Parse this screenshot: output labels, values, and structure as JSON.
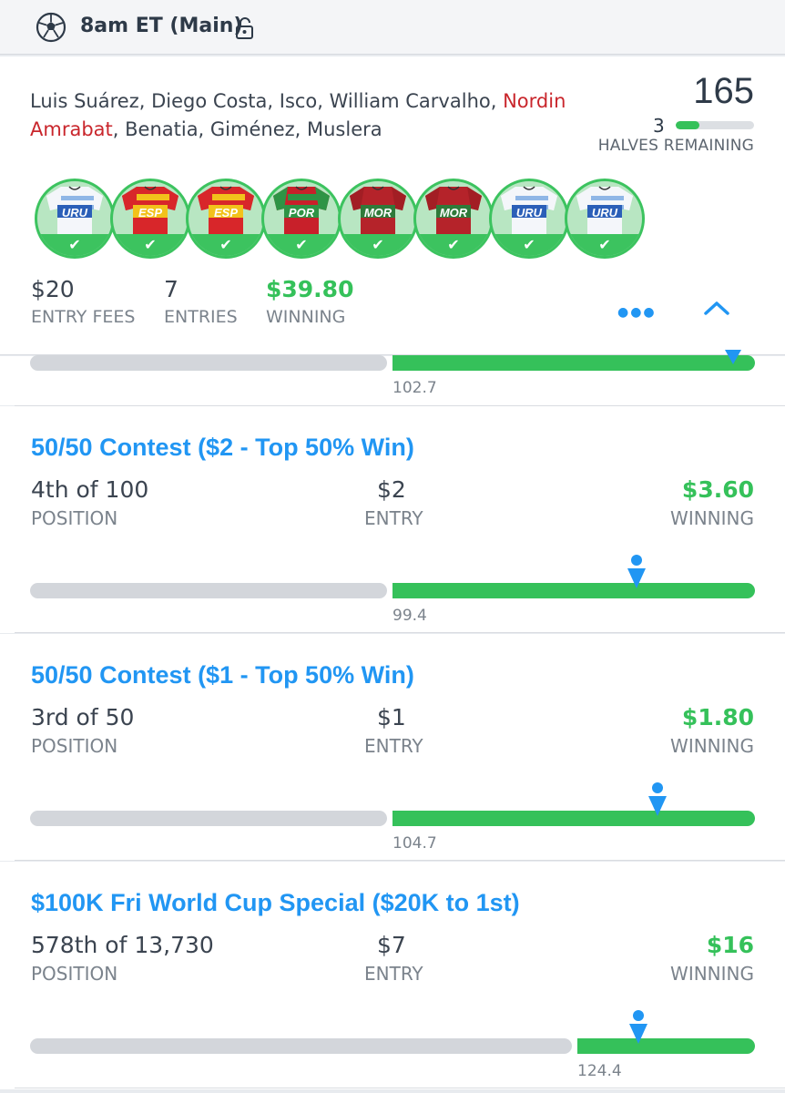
{
  "header": {
    "title": "8am ET (Main)",
    "sport_icon": "soccer-ball-icon",
    "lock_icon": "unlocked-padlock-icon"
  },
  "lineup": {
    "players_before": "Luis Suárez, Diego Costa, Isco, William Carvalho, ",
    "players_red": "Nordin Amrabat",
    "players_after": ", Benatia, Giménez, Muslera",
    "points": "165",
    "halves_remaining": "3",
    "halves_progress": 0.3,
    "halves_label": "HALVES REMAINING",
    "jerseys": [
      {
        "code": "URU"
      },
      {
        "code": "ESP"
      },
      {
        "code": "ESP"
      },
      {
        "code": "POR"
      },
      {
        "code": "MOR"
      },
      {
        "code": "MOR"
      },
      {
        "code": "URU"
      },
      {
        "code": "URU"
      }
    ],
    "entry_fees": "$20",
    "entry_fees_label": "ENTRY FEES",
    "entries": "7",
    "entries_label": "ENTRIES",
    "winning": "$39.80",
    "winning_label": "WINNING",
    "more_icon": "more-dots-icon",
    "collapse_icon": "chevron-up-icon"
  },
  "first_bar": {
    "score": "102.7"
  },
  "contests": [
    {
      "title": "50/50 Contest ($2 - Top 50% Win)",
      "position": "4th of 100",
      "position_label": "POSITION",
      "entry": "$2",
      "entry_label": "ENTRY",
      "winning": "$3.60",
      "winning_label": "WINNING",
      "cutoff": "99.4"
    },
    {
      "title": "50/50 Contest ($1 - Top 50% Win)",
      "position": "3rd of 50",
      "position_label": "POSITION",
      "entry": "$1",
      "entry_label": "ENTRY",
      "winning": "$1.80",
      "winning_label": "WINNING",
      "cutoff": "104.7"
    },
    {
      "title": "$100K Fri World Cup Special ($20K to 1st)",
      "position": "578th of 13,730",
      "position_label": "POSITION",
      "entry": "$7",
      "entry_label": "ENTRY",
      "winning": "$16",
      "winning_label": "WINNING",
      "cutoff": "124.4"
    }
  ],
  "colors": {
    "accent_blue": "#2196f3",
    "win_green": "#35c15a",
    "alert_red": "#c9262c"
  }
}
